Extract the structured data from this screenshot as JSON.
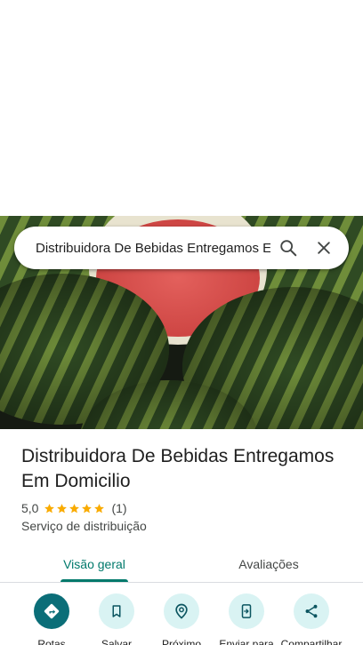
{
  "search": {
    "query": "Distribuidora De Bebidas Entregamos Em Domicilio"
  },
  "place": {
    "title": "Distribuidora De Bebidas Entregamos Em Domicilio",
    "rating": "5,0",
    "stars": 5,
    "review_count": "(1)",
    "category": "Serviço de distribuição"
  },
  "tabs": [
    {
      "label": "Visão geral",
      "active": true
    },
    {
      "label": "Avaliações",
      "active": false
    }
  ],
  "actions": [
    {
      "label": "Rotas",
      "icon": "directions-icon"
    },
    {
      "label": "Salvar",
      "icon": "bookmark-icon"
    },
    {
      "label": "Próximo",
      "icon": "nearby-icon"
    },
    {
      "label": "Enviar para",
      "icon": "send-to-phone-icon"
    },
    {
      "label": "Compartilhar",
      "icon": "share-icon"
    }
  ],
  "colors": {
    "accent": "#00796b",
    "primary_button": "#0b6e78",
    "secondary_button": "#d9f3f3",
    "star": "#f9ab00"
  }
}
